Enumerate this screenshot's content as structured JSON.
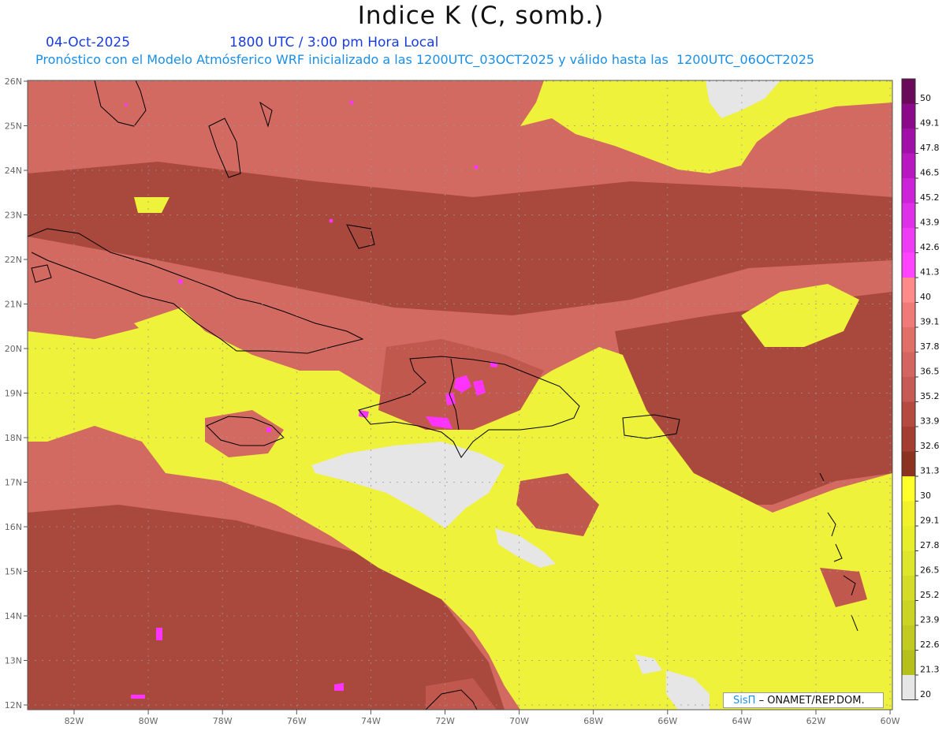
{
  "header": {
    "title": "Indice K (C, somb.)",
    "date": "04-Oct-2025",
    "time": "1800 UTC / 3:00 pm Hora Local",
    "forecast_info": "Pronóstico con el Modelo Atmósferico WRF inicializado a las 1200UTC_03OCT2025 y válido hasta las  1200UTC_06OCT2025"
  },
  "map": {
    "lon_labels": [
      "82W",
      "80W",
      "78W",
      "76W",
      "74W",
      "72W",
      "70W",
      "68W",
      "66W",
      "64W",
      "62W",
      "60W"
    ],
    "lat_labels": [
      "26N",
      "25N",
      "24N",
      "23N",
      "22N",
      "21N",
      "20N",
      "19N",
      "18N",
      "17N",
      "16N",
      "15N",
      "14N",
      "13N",
      "12N"
    ],
    "colors": {
      "no_data": "#e6e6e6",
      "low_k": "#eef23a",
      "high_k": "#d36a62",
      "very_high_k": "#9a3a2a",
      "extreme_k": "#ff33ff",
      "coastline": "#000000"
    }
  },
  "colorbar": {
    "labels": [
      "50",
      "49.1",
      "47.8",
      "46.5",
      "45.2",
      "43.9",
      "42.6",
      "41.3",
      "40",
      "39.1",
      "37.8",
      "36.5",
      "35.2",
      "33.9",
      "32.6",
      "31.3",
      "30",
      "29.1",
      "27.8",
      "26.5",
      "25.2",
      "23.9",
      "22.6",
      "21.3",
      "20"
    ],
    "colors": [
      "#6a0a5a",
      "#8a0a8a",
      "#a010a8",
      "#b818c0",
      "#cc22d8",
      "#dd30e8",
      "#ee3cf4",
      "#ff44ff",
      "#ff8a8a",
      "#f07a78",
      "#e06f68",
      "#d36460",
      "#c65a55",
      "#b44a40",
      "#a43e30",
      "#8c3220",
      "#ffff2a",
      "#f2f22a",
      "#e8ee2a",
      "#dde62a",
      "#d4dc28",
      "#cad424",
      "#c0ca20",
      "#b6c01c",
      "#e6e6e6"
    ]
  },
  "credit": {
    "brand": "SisΠ",
    "text": "– ONAMET/REP.DOM."
  }
}
